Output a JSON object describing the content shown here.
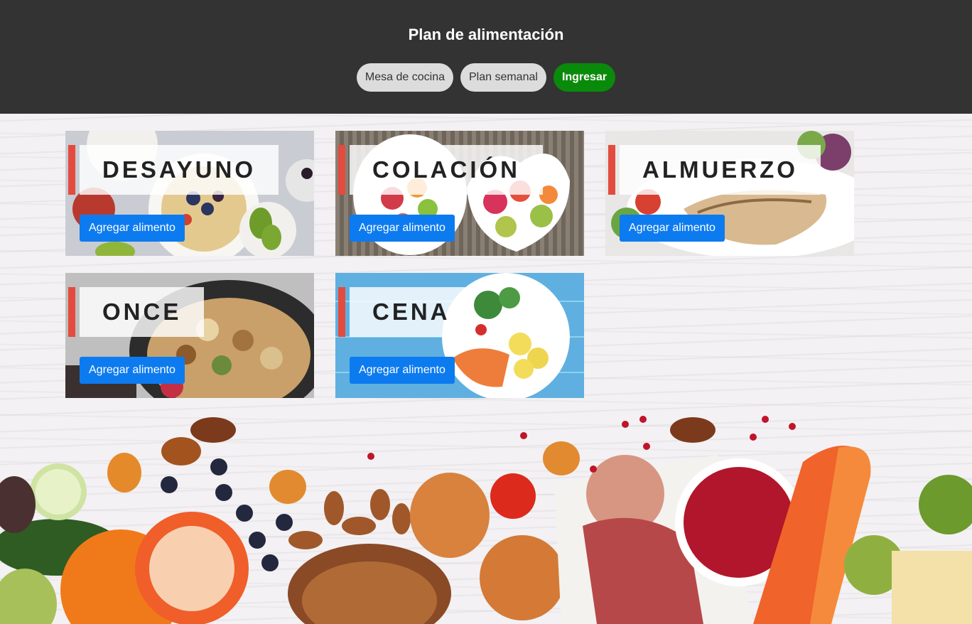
{
  "header": {
    "title": "Plan de alimentación",
    "nav": [
      {
        "label": "Mesa de cocina"
      },
      {
        "label": "Plan semanal"
      },
      {
        "label": "Ingresar"
      }
    ]
  },
  "meals": [
    {
      "title": "DESAYUNO",
      "button": "Agregar alimento"
    },
    {
      "title": "COLACIÓN",
      "button": "Agregar alimento"
    },
    {
      "title": "ALMUERZO",
      "button": "Agregar alimento"
    },
    {
      "title": "ONCE",
      "button": "Agregar alimento"
    },
    {
      "title": "CENA",
      "button": "Agregar alimento"
    }
  ],
  "colors": {
    "header_bg": "#333333",
    "login_green": "#0a8a0a",
    "accent_red": "#e34b3f",
    "button_blue": "#0d7bf0"
  }
}
